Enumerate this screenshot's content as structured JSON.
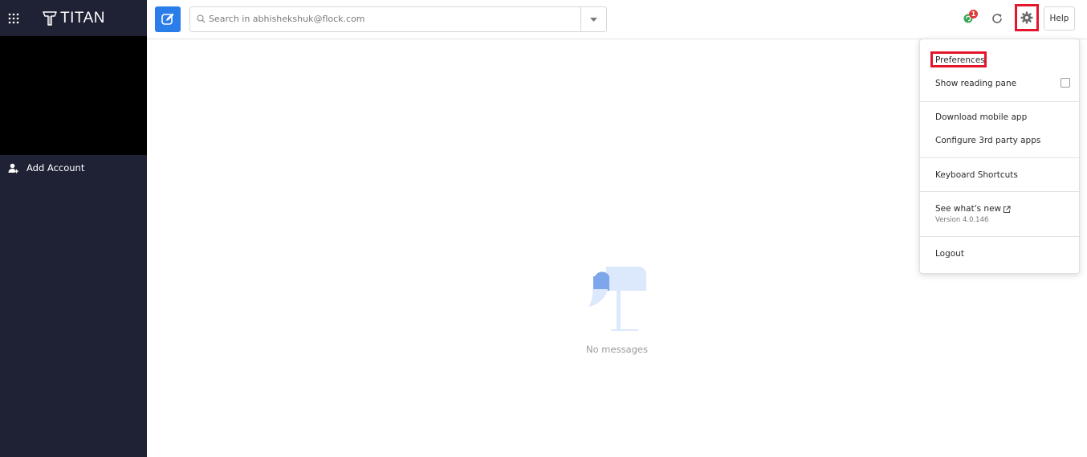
{
  "app": {
    "logo_text": "TITAN",
    "accent_color": "#2b7de9",
    "sidebar_color": "#1f2235"
  },
  "sidebar": {
    "apps_icon": "grid-icon",
    "add_account_label": "Add Account"
  },
  "toolbar": {
    "search_placeholder": "Search in abhishekshuk@flock.com",
    "notification_count": "1",
    "help_label": "Help"
  },
  "settings_menu": {
    "items": {
      "preferences": "Preferences",
      "show_reading_pane": "Show reading pane",
      "download_mobile_app": "Download mobile app",
      "configure_3rd_party": "Configure 3rd party apps",
      "keyboard_shortcuts": "Keyboard Shortcuts",
      "see_whats_new": "See what's new",
      "version": "Version 4.0.146",
      "logout": "Logout"
    }
  },
  "main": {
    "empty_state_text": "No messages"
  }
}
